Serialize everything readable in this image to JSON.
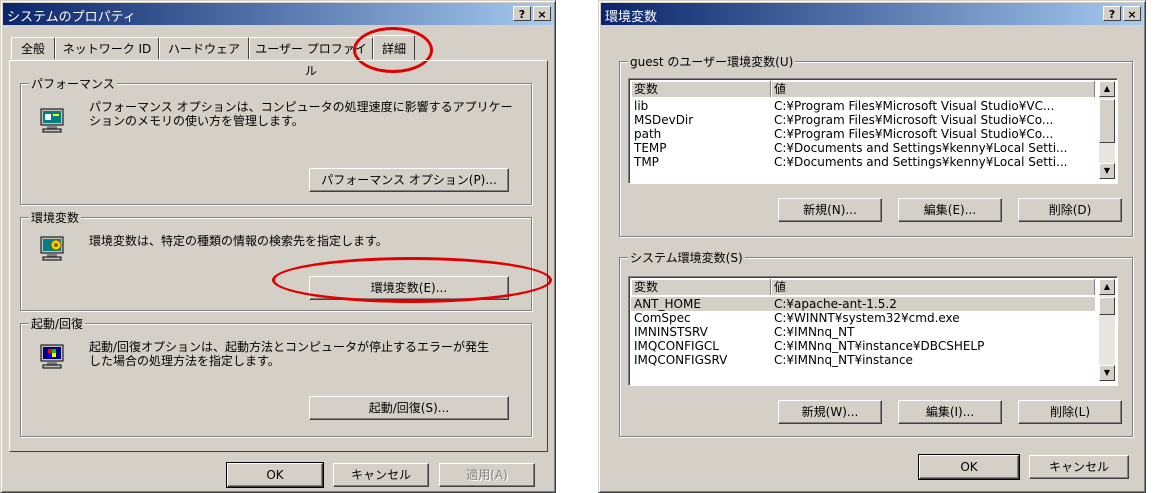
{
  "left_window": {
    "title": "システムのプロパティ",
    "help_btn": "?",
    "close_btn": "×",
    "tabs": [
      "全般",
      "ネットワーク ID",
      "ハードウェア",
      "ユーザー プロファイル",
      "詳細"
    ],
    "performance": {
      "label": "パフォーマンス",
      "desc1": "パフォーマンス オプションは、コンピュータの処理速度に影響するアプリケー",
      "desc2": "ションのメモリの使い方を管理します。",
      "button": "パフォーマンス オプション(P)..."
    },
    "env": {
      "label": "環境変数",
      "desc": "環境変数は、特定の種類の情報の検索先を指定します。",
      "button": "環境変数(E)..."
    },
    "startup": {
      "label": "起動/回復",
      "desc1": "起動/回復オプションは、起動方法とコンピュータが停止するエラーが発生",
      "desc2": "した場合の処理方法を指定します。",
      "button": "起動/回復(S)..."
    },
    "ok": "OK",
    "cancel": "キャンセル",
    "apply": "適用(A)"
  },
  "right_window": {
    "title": "環境変数",
    "help_btn": "?",
    "close_btn": "×",
    "user_group": "guest のユーザー環境変数(U)",
    "col_var": "変数",
    "col_val": "値",
    "user_vars": [
      {
        "name": "lib",
        "value": "C:¥Program Files¥Microsoft Visual Studio¥VC..."
      },
      {
        "name": "MSDevDir",
        "value": "C:¥Program Files¥Microsoft Visual Studio¥Co..."
      },
      {
        "name": "path",
        "value": "C:¥Program Files¥Microsoft Visual Studio¥Co..."
      },
      {
        "name": "TEMP",
        "value": "C:¥Documents and Settings¥kenny¥Local Setti..."
      },
      {
        "name": "TMP",
        "value": "C:¥Documents and Settings¥kenny¥Local Setti..."
      }
    ],
    "user_new": "新規(N)...",
    "user_edit": "編集(E)...",
    "user_delete": "削除(D)",
    "system_group": "システム環境変数(S)",
    "system_vars": [
      {
        "name": "ANT_HOME",
        "value": "C:¥apache-ant-1.5.2"
      },
      {
        "name": "ComSpec",
        "value": "C:¥WINNT¥system32¥cmd.exe"
      },
      {
        "name": "IMNINSTSRV",
        "value": "C:¥IMNnq_NT"
      },
      {
        "name": "IMQCONFIGCL",
        "value": "C:¥IMNnq_NT¥instance¥DBCSHELP"
      },
      {
        "name": "IMQCONFIGSRV",
        "value": "C:¥IMNnq_NT¥instance"
      }
    ],
    "sys_new": "新規(W)...",
    "sys_edit": "編集(I)...",
    "sys_delete": "削除(L)",
    "ok": "OK",
    "cancel": "キャンセル"
  },
  "highlight_color": "#e00000"
}
